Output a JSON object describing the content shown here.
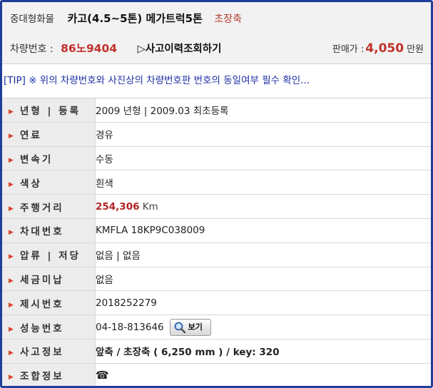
{
  "header": {
    "category": "중대형화물",
    "model": "카고(4.5~5톤) 메가트럭5톤",
    "axle": "초장축",
    "plate_label": "차량번호 :",
    "plate": "86노9404",
    "history_link": "▷사고이력조회하기",
    "price_label": "판매가 :",
    "price_value": "4,050",
    "price_unit": "만원"
  },
  "tip": "[TIP] ※ 위의 차량번호와 사진상의 차량번호판 번호의 동일여부 필수 확인...",
  "specs": {
    "year": {
      "label": "년형 | 등록",
      "value": "2009 년형 | 2009.03 최초등록"
    },
    "fuel": {
      "label": "연료",
      "value": "경유"
    },
    "transmission": {
      "label": "변속기",
      "value": "수동"
    },
    "color": {
      "label": "색상",
      "value": "흰색"
    },
    "mileage": {
      "label": "주행거리",
      "value": "254,306",
      "unit": "Km"
    },
    "vin": {
      "label": "차대번호",
      "value": "KMFLA 18KP9C038009"
    },
    "seizure": {
      "label": "압류 | 저당",
      "value": "없음 | 없음"
    },
    "tax": {
      "label": "세금미납",
      "value": "없음"
    },
    "presentation": {
      "label": "제시번호",
      "value": "2018252279"
    },
    "performance": {
      "label": "성능번호",
      "value": "04-18-813646",
      "button": "보기"
    },
    "accident": {
      "label": "사고정보",
      "value": "앞축 / 초장축 ( 6,250 mm ) / key: 320"
    },
    "union": {
      "label": "조합정보",
      "value": "☎"
    }
  },
  "icons": {
    "row_marker": "arrow-right-icon",
    "magnifier": "magnifier-icon",
    "phone": "phone-icon"
  },
  "colors": {
    "border": "#1f3f9a",
    "accent_red": "#c0312b",
    "tip_blue": "#1d2fa6"
  }
}
